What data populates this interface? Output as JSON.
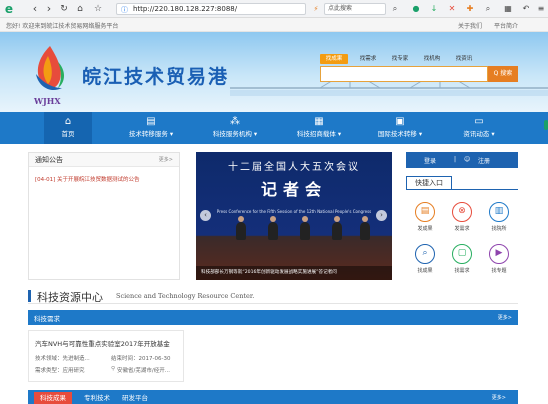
{
  "browser": {
    "url": "http://220.180.128.227:8088/",
    "search_text": "点此搜索",
    "buttons": [
      "browser-logo-icon",
      "back-icon",
      "forward-icon",
      "refresh-icon",
      "home-icon",
      "star-icon"
    ]
  },
  "topbar": {
    "welcome": "您好! 欢迎来到皖江技术贸易网络服务平台",
    "about": "关于我们",
    "intro": "平台简介"
  },
  "header": {
    "title": "皖江技术贸易港",
    "logo_abbr": "WJHX",
    "search_tabs": [
      "找成果",
      "找需求",
      "找专家",
      "找机构",
      "找资讯"
    ],
    "search_button": "Q 搜索"
  },
  "nav": [
    {
      "icon": "home-icon",
      "label": "首页"
    },
    {
      "icon": "doc-icon",
      "label": "技术转移服务 ▾"
    },
    {
      "icon": "network-icon",
      "label": "科技服务机构 ▾"
    },
    {
      "icon": "building-icon",
      "label": "科技招商载体 ▾"
    },
    {
      "icon": "transfer-icon",
      "label": "国际技术转移 ▾"
    },
    {
      "icon": "news-icon",
      "label": "资讯动态 ▾"
    }
  ],
  "notice": {
    "title": "通知公告",
    "more": "更多>",
    "items": [
      "[04-01] 关于开展皖江技贸数据测试的公告"
    ]
  },
  "banner": {
    "headline": "十二届全国人大五次会议",
    "main": "记者会",
    "subtitle": "Press Conference for the Fifth Session of the 12th National People's Congress",
    "caption": "科技部部长万钢等就“2016年创新驱动发展战略实施进展”答记者问"
  },
  "login": {
    "login": "登录",
    "register": "注册"
  },
  "quick": {
    "title": "快捷入口",
    "items": [
      {
        "label": "发成果",
        "icon": "publish-result-icon",
        "color": "#e67e22"
      },
      {
        "label": "发需求",
        "icon": "publish-demand-icon",
        "color": "#e74c3c"
      },
      {
        "label": "找院所",
        "icon": "institute-icon",
        "color": "#1e79c8"
      },
      {
        "label": "找成果",
        "icon": "find-result-icon",
        "color": "#1e63b0"
      },
      {
        "label": "找需求",
        "icon": "find-demand-icon",
        "color": "#27ae60"
      },
      {
        "label": "找专题",
        "icon": "topic-icon",
        "color": "#8e44ad"
      }
    ]
  },
  "resource_center": {
    "title": "科技资源中心",
    "title_en": "Science and Technology Resource Center.",
    "demand_label": "科技需求",
    "more": "更多>",
    "card": {
      "title": "汽车NVH与可靠性重点实验室2017年开放基金",
      "field": "技术领域：先进制造...",
      "deadline": "结束时间：2017-06-30",
      "type": "需求类型：应用研究",
      "location": "安徽省/芜湖市/经开..."
    },
    "bottom_tabs": [
      "科技成果",
      "专利技术",
      "研发平台"
    ],
    "bottom_more": "更多>"
  }
}
